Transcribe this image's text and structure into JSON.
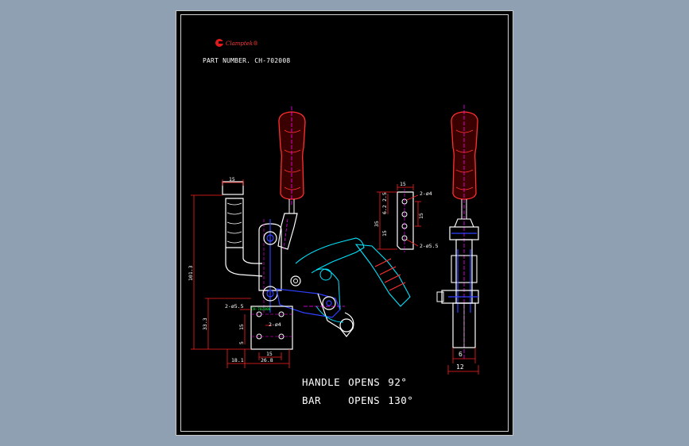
{
  "title_block": {
    "brand": "Clamptek®",
    "part_number": "PART NUMBER. CH-702008"
  },
  "notes": {
    "handle_label": "HANDLE",
    "handle_opens_word": "OPENS",
    "handle_angle": "92°",
    "bar_label": "BAR",
    "bar_opens_word": "OPENS",
    "bar_angle": "130°"
  },
  "dimensions": {
    "front": {
      "top_width": "15",
      "overall_height": "101.3",
      "base_height": "33.3",
      "hole_spacing_v": "15",
      "hole_offset_v": "5",
      "base_width": "15",
      "offset_a": "18.1",
      "offset_b": "26.8",
      "hole_callout_a": "2-ø5.5",
      "hole_callout_b": "2-ø4",
      "body_stamp": "CH-702008"
    },
    "plate": {
      "width": "15",
      "dim_a": "2.5",
      "dim_b": "6.2",
      "height": "35",
      "spacing_v": "15",
      "spacing_w": "15",
      "hole_callout_a": "2-ø4",
      "hole_callout_b": "2-ø5.5"
    },
    "side": {
      "width_small": "6",
      "width_large": "12"
    }
  },
  "colors": {
    "background": "#8fa0b3",
    "sheet": "#000000",
    "part_outline": "#ffffff",
    "dimension": "#ff2020",
    "dimension_text": "#ffffff",
    "handle_grip": "#ff3030",
    "centerline": "#ff00ff",
    "pivot": "#3040ff",
    "open_position": "#00e5ff",
    "callout": "#00ff40",
    "brand": "#e01a1a"
  }
}
